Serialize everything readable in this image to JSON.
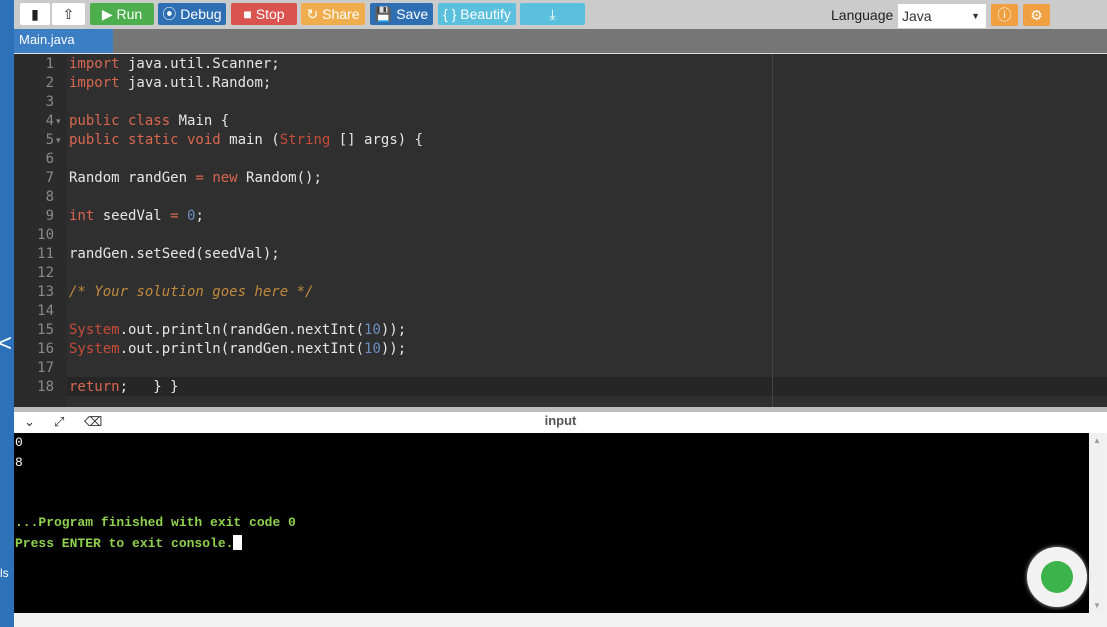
{
  "toolbar": {
    "run": "▶ Run",
    "debug": "⦿ Debug",
    "stop": "■ Stop",
    "share": "↻ Share",
    "save": "💾 Save",
    "beautify": "{ } Beautify",
    "download": "⤓",
    "language_label": "Language",
    "language_value": "Java",
    "colors": {
      "run": "#4cae4c",
      "debug": "#2e6fb3",
      "stop": "#d9534f",
      "share": "#f0ad4e",
      "save": "#2e6fb3",
      "beautify": "#5bc0de"
    }
  },
  "tab": {
    "label": "Main.java"
  },
  "code": [
    [
      [
        "kw",
        "import"
      ],
      [
        "t",
        " java.util.Scanner;"
      ]
    ],
    [
      [
        "kw",
        "import"
      ],
      [
        "t",
        " java.util.Random;"
      ]
    ],
    [],
    [
      [
        "kw",
        "public class"
      ],
      [
        "t",
        " Main {"
      ]
    ],
    [
      [
        "kw",
        "public static void"
      ],
      [
        "t",
        " main ("
      ],
      [
        "str",
        "String"
      ],
      [
        "t",
        " [] args) {"
      ]
    ],
    [],
    [
      [
        "t",
        "Random randGen "
      ],
      [
        "kw",
        "="
      ],
      [
        "t",
        " "
      ],
      [
        "kw",
        "new"
      ],
      [
        "t",
        " Random();"
      ]
    ],
    [],
    [
      [
        "kw",
        "int"
      ],
      [
        "t",
        " seedVal "
      ],
      [
        "kw",
        "="
      ],
      [
        "t",
        " "
      ],
      [
        "num",
        "0"
      ],
      [
        "t",
        ";"
      ]
    ],
    [],
    [
      [
        "t",
        "randGen.setSeed(seedVal);"
      ]
    ],
    [],
    [
      [
        "com",
        "/* Your solution goes here */"
      ]
    ],
    [],
    [
      [
        "str",
        "System"
      ],
      [
        "t",
        ".out.println(randGen.nextInt("
      ],
      [
        "num",
        "10"
      ],
      [
        "t",
        "));"
      ]
    ],
    [
      [
        "str",
        "System"
      ],
      [
        "t",
        ".out.println(randGen.nextInt("
      ],
      [
        "num",
        "10"
      ],
      [
        "t",
        "));"
      ]
    ],
    [],
    [
      [
        "kw",
        "return"
      ],
      [
        "t",
        ";   } }"
      ]
    ]
  ],
  "input_bar": {
    "title": "input"
  },
  "console": {
    "outputs": [
      "0",
      "8"
    ],
    "finished": "...Program finished with exit code 0",
    "prompt": "Press ENTER to exit console."
  },
  "sidebar": {
    "collapse": "<",
    "partial_text": "ls"
  }
}
